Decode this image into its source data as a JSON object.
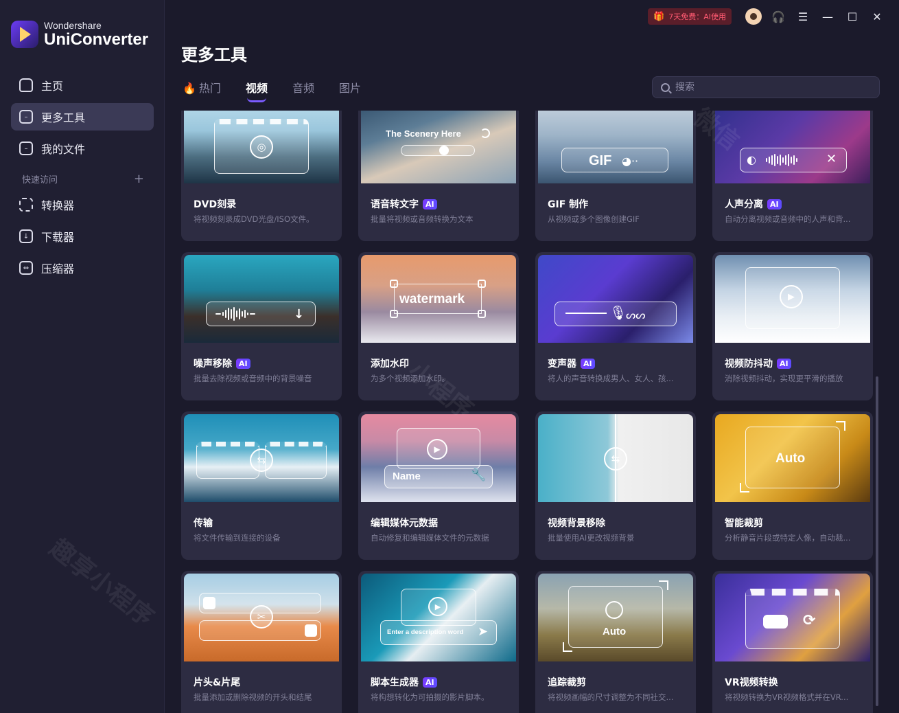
{
  "app": {
    "brand": "Wondershare",
    "product": "UniConverter"
  },
  "topbar": {
    "promo_label": "7天免费：AI使用",
    "icons": [
      "gift-icon",
      "avatar",
      "headset-icon",
      "menu-list-icon",
      "minimize-icon",
      "maximize-icon",
      "close-icon"
    ]
  },
  "sidebar": {
    "items": [
      {
        "label": "主页",
        "icon": "home-icon"
      },
      {
        "label": "更多工具",
        "icon": "toolbox-icon",
        "active": true
      },
      {
        "label": "我的文件",
        "icon": "file-icon"
      }
    ],
    "quick_access_label": "快速访问",
    "quick_items": [
      {
        "label": "转换器",
        "icon": "converter-icon"
      },
      {
        "label": "下载器",
        "icon": "downloader-icon"
      },
      {
        "label": "压缩器",
        "icon": "compressor-icon"
      }
    ]
  },
  "main": {
    "title": "更多工具",
    "tabs": [
      {
        "label": "热门",
        "icon": "flame-icon"
      },
      {
        "label": "视频",
        "active": true
      },
      {
        "label": "音频"
      },
      {
        "label": "图片"
      }
    ],
    "search_placeholder": "搜索"
  },
  "cards": [
    {
      "title": "DVD刻录",
      "ai": false,
      "desc": "将视频刻录成DVD光盘/ISO文件。"
    },
    {
      "title": "语音转文字",
      "ai": true,
      "desc": "批量将视频或音频转换为文本",
      "overlay_text": "The Scenery Here"
    },
    {
      "title": "GIF 制作",
      "ai": false,
      "desc": "从视频或多个图像创建GIF",
      "overlay_text": "GIF"
    },
    {
      "title": "人声分离",
      "ai": true,
      "desc": "自动分离视频或音频中的人声和背..."
    },
    {
      "title": "噪声移除",
      "ai": true,
      "desc": "批量去除视频或音频中的背景噪音"
    },
    {
      "title": "添加水印",
      "ai": false,
      "desc": "为多个视频添加水印。",
      "overlay_text": "watermark"
    },
    {
      "title": "变声器",
      "ai": true,
      "desc": "将人的声音转换成男人、女人、孩..."
    },
    {
      "title": "视频防抖动",
      "ai": true,
      "desc": "消除视频抖动，实现更平滑的播放"
    },
    {
      "title": "传输",
      "ai": false,
      "desc": "将文件传输到连接的设备"
    },
    {
      "title": "编辑媒体元数据",
      "ai": false,
      "desc": "自动修复和编辑媒体文件的元数据",
      "overlay_text": "Name"
    },
    {
      "title": "视频背景移除",
      "ai": false,
      "desc": "批量使用AI更改视频背景"
    },
    {
      "title": "智能裁剪",
      "ai": false,
      "desc": "分析静音片段或特定人像，自动裁...",
      "overlay_text": "Auto"
    },
    {
      "title": "片头&片尾",
      "ai": false,
      "desc": "批量添加或删除视频的开头和结尾"
    },
    {
      "title": "脚本生成器",
      "ai": true,
      "desc": "将构想转化为可拍摄的影片脚本。",
      "overlay_text": "Enter a description word"
    },
    {
      "title": "追踪裁剪",
      "ai": false,
      "desc": "将视频画幅的尺寸调整为不同社交...",
      "overlay_text": "Auto"
    },
    {
      "title": "VR视频转换",
      "ai": false,
      "desc": "将视频转换为VR视频格式并在VR..."
    }
  ],
  "ai_badge_label": "AI",
  "watermarks": [
    "小程序",
    "趣享小程序",
    "微信"
  ]
}
